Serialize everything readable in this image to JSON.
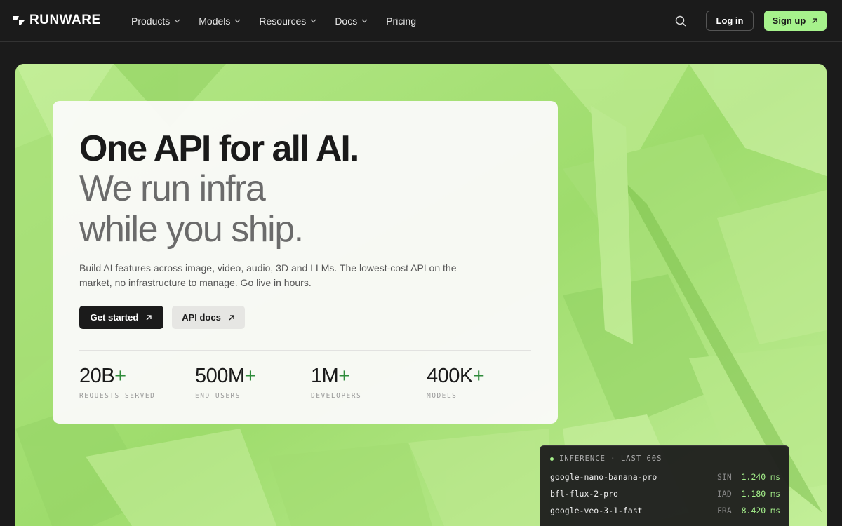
{
  "brand": {
    "name": "RUNWARE"
  },
  "nav": {
    "items": [
      {
        "label": "Products",
        "has_dropdown": true
      },
      {
        "label": "Models",
        "has_dropdown": true
      },
      {
        "label": "Resources",
        "has_dropdown": true
      },
      {
        "label": "Docs",
        "has_dropdown": true
      },
      {
        "label": "Pricing",
        "has_dropdown": false
      }
    ],
    "search_icon": "search-icon",
    "login_label": "Log in",
    "signup_label": "Sign up"
  },
  "hero": {
    "headline": "One API for all AI.",
    "subline_1": "We run infra",
    "subline_2": "while you ship.",
    "description": "Build AI features across image, video, audio, 3D and LLMs. The lowest-cost API on the market, no infrastructure to manage. Go live in hours.",
    "primary_cta": "Get started",
    "secondary_cta": "API docs",
    "stats": [
      {
        "value": "20B",
        "plus": "+",
        "label": "REQUESTS SERVED"
      },
      {
        "value": "500M",
        "plus": "+",
        "label": "END USERS"
      },
      {
        "value": "1M",
        "plus": "+",
        "label": "DEVELOPERS"
      },
      {
        "value": "400K",
        "plus": "+",
        "label": "MODELS"
      }
    ]
  },
  "inference": {
    "title": "INFERENCE · LAST 60S",
    "rows": [
      {
        "model": "google-nano-banana-pro",
        "region": "SIN",
        "latency": "1.240 ms"
      },
      {
        "model": "bfl-flux-2-pro",
        "region": "IAD",
        "latency": "1.180 ms"
      },
      {
        "model": "google-veo-3-1-fast",
        "region": "FRA",
        "latency": "8.420 ms"
      }
    ]
  },
  "colors": {
    "accent": "#a6f28c",
    "background": "#1b1b1b",
    "hero_green": "#a7e276"
  }
}
